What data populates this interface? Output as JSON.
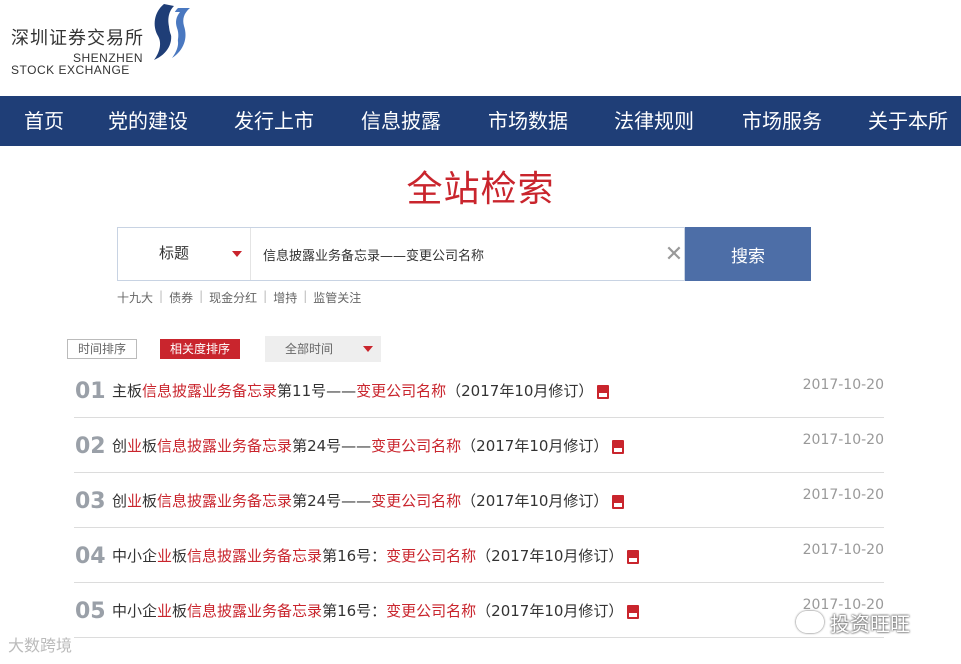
{
  "header": {
    "logo_cn": "深圳证券交易所",
    "logo_en_line1": "SHENZHEN",
    "logo_en_line2": "STOCK EXCHANGE",
    "logo_icon": "szse-logo-icon",
    "brand_color": "#1f3e77",
    "accent_color": "#c9252d"
  },
  "nav": {
    "items": [
      "首页",
      "党的建设",
      "发行上市",
      "信息披露",
      "市场数据",
      "法律规则",
      "市场服务",
      "关于本所"
    ]
  },
  "page_title": "全站检索",
  "search": {
    "type_label": "标题",
    "query": "信息披露业务备忘录——变更公司名称",
    "button_label": "搜索",
    "clear_icon": "close-icon"
  },
  "hotwords": [
    "十九大",
    "债券",
    "现金分红",
    "增持",
    "监管关注"
  ],
  "sort": {
    "time_label": "时间排序",
    "relevance_label": "相关度排序",
    "time_filter_label": "全部时间"
  },
  "results": [
    {
      "index": "01",
      "parts": [
        "主板",
        "信息披露业务备忘录",
        "第11号——",
        "变更公司名称",
        "（2017年10月修订）"
      ],
      "date": "2017-10-20"
    },
    {
      "index": "02",
      "parts": [
        "创",
        "业",
        "板",
        "信息披露业务备忘录",
        "第24号——",
        "变更公司名称",
        "（2017年10月修订）"
      ],
      "date": "2017-10-20"
    },
    {
      "index": "03",
      "parts": [
        "创",
        "业",
        "板",
        "信息披露业务备忘录",
        "第24号——",
        "变更公司名称",
        "（2017年10月修订）"
      ],
      "date": "2017-10-20"
    },
    {
      "index": "04",
      "parts": [
        "中小企",
        "业",
        "板",
        "信息披露业务备忘录",
        "第16号：",
        "变更公司名称",
        "（2017年10月修订）"
      ],
      "date": "2017-10-20"
    },
    {
      "index": "05",
      "parts": [
        "中小企",
        "业",
        "板",
        "信息披露业务备忘录",
        "第16号：",
        "变更公司名称",
        "（2017年10月修订）"
      ],
      "date": "2017-10-20"
    }
  ],
  "watermarks": {
    "left": "大数跨境",
    "right": "投资旺旺"
  }
}
